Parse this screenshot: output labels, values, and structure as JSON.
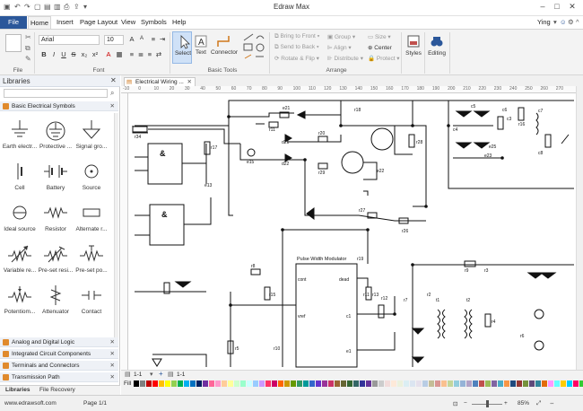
{
  "app": {
    "title": "Edraw Max",
    "user": "Ying"
  },
  "menu": {
    "file": "File",
    "items": [
      "Home",
      "Insert",
      "Page Layout",
      "View",
      "Symbols",
      "Help"
    ]
  },
  "ribbon": {
    "font_name": "Arial",
    "font_size": "10",
    "font_group": "File",
    "font_label": "Font",
    "select": "Select",
    "text": "Text",
    "connector": "Connector",
    "basic_tools": "Basic Tools",
    "arrange": {
      "bring_to_front": "Bring to Front",
      "send_to_back": "Send to Back",
      "rotate_flip": "Rotate & Flip",
      "group": "Group",
      "align": "Align",
      "distribute": "Distribute",
      "size": "Size",
      "center": "Center",
      "protect": "Protect",
      "label": "Arrange"
    },
    "styles": "Styles",
    "editing": "Editing"
  },
  "library": {
    "title": "Libraries",
    "category_open": "Basic Electrical Symbols",
    "symbols": [
      [
        "Earth electr...",
        "Protective ...",
        "Signal gro..."
      ],
      [
        "Cell",
        "Battery",
        "Source"
      ],
      [
        "Ideal source",
        "Resistor",
        "Alternate r..."
      ],
      [
        "Variable re...",
        "Pre-set resi...",
        "Pre-set po..."
      ],
      [
        "Potentiom...",
        "Attenuator",
        "Contact"
      ]
    ],
    "categories": [
      "Analog and Digital Logic",
      "Integrated Circuit Components",
      "Terminals and Connectors",
      "Transmission Path"
    ],
    "tabs": [
      "Libraries",
      "File Recovery"
    ]
  },
  "document": {
    "tab": "Electrical Wiring ...",
    "ruler_ticks": [
      "-10",
      "0",
      "10",
      "20",
      "30",
      "40",
      "50",
      "60",
      "70",
      "80",
      "90",
      "100",
      "110",
      "120",
      "130",
      "140",
      "150",
      "160",
      "170",
      "180",
      "190",
      "200",
      "210",
      "220",
      "230",
      "240",
      "250",
      "260",
      "270"
    ],
    "page_tab": "1-1",
    "fill_label": "Fill"
  },
  "diagram": {
    "module_title": "Pulse Width Modulator",
    "pins": {
      "cont": "cont",
      "dead": "dead",
      "vref": "vref",
      "c1": "c1",
      "e1": "e1",
      "r11": "r11"
    },
    "gate": "&",
    "labels": [
      "r34",
      "r17",
      "e21",
      "r11",
      "d21",
      "r20",
      "d22",
      "r18",
      "e15",
      "r29",
      "r28",
      "r12",
      "r27",
      "r26",
      "e22",
      "e13",
      "e23",
      "r16",
      "r19",
      "c4",
      "c5",
      "c6",
      "c3",
      "c7",
      "c8",
      "e25",
      "t2",
      "t1",
      "r9",
      "r3",
      "r4",
      "r7",
      "r5",
      "r2",
      "r6",
      "r8",
      "r10",
      "r15",
      "r13"
    ]
  },
  "status": {
    "url": "www.edrawsoft.com",
    "page": "Page 1/1",
    "zoom": "85%"
  },
  "palette": [
    "#000000",
    "#7f7f7f",
    "#c00000",
    "#ff0000",
    "#ffc000",
    "#ffff00",
    "#92d050",
    "#00b050",
    "#00b0f0",
    "#0070c0",
    "#002060",
    "#7030a0",
    "#ff6699",
    "#ff99cc",
    "#ffcc99",
    "#ffff99",
    "#ccffcc",
    "#99ffcc",
    "#ccffff",
    "#99ccff",
    "#cc99ff",
    "#ff3366",
    "#cc0066",
    "#ff6600",
    "#cc9900",
    "#669900",
    "#339966",
    "#009999",
    "#3366cc",
    "#6633cc",
    "#993399",
    "#cc3366",
    "#996633",
    "#666633",
    "#336633",
    "#336666",
    "#333399",
    "#663399",
    "#999999",
    "#cccccc",
    "#f2dcdb",
    "#fde9d9",
    "#ebf1dd",
    "#dbeef3",
    "#dbe5f1",
    "#e5e0ec",
    "#b8cce4",
    "#c4bd97",
    "#d99694",
    "#fac08f",
    "#c3d69b",
    "#93cddd",
    "#95b3d7",
    "#b2a2c7",
    "#4f81bd",
    "#c0504d",
    "#9bbb59",
    "#8064a2",
    "#4bacc6",
    "#f79646",
    "#1f497d",
    "#953734",
    "#76923c",
    "#5f497a",
    "#31859b",
    "#e36c09",
    "#ff99ff",
    "#66ffff",
    "#ffcc00",
    "#00ccff",
    "#ff0066",
    "#33cc33"
  ]
}
